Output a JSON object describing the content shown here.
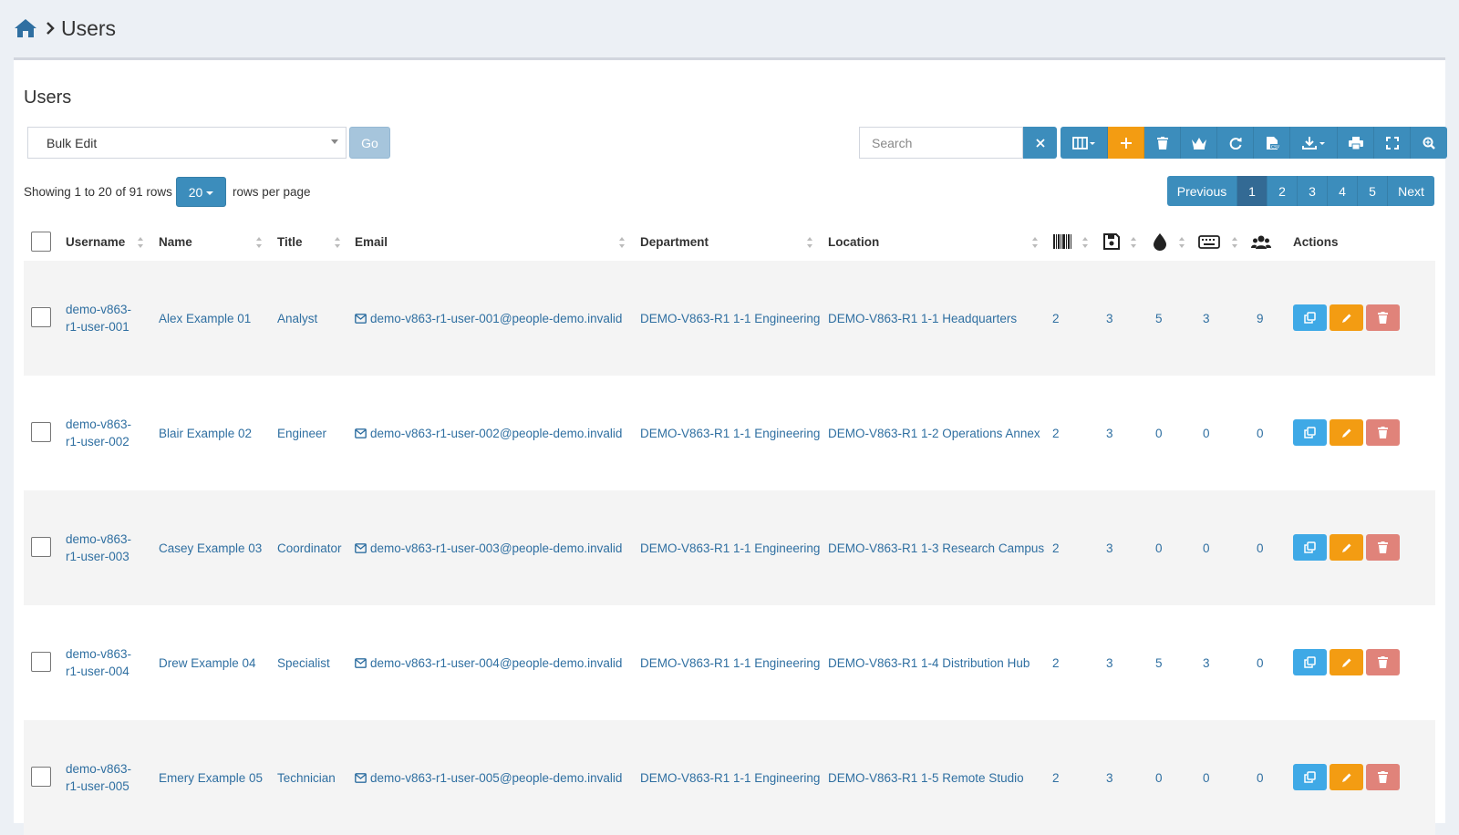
{
  "breadcrumb": {
    "title": "Users"
  },
  "panel": {
    "title": "Users"
  },
  "bulk": {
    "selected": "Bulk Edit",
    "go_label": "Go"
  },
  "search": {
    "placeholder": "Search"
  },
  "toolbar": {
    "buttons": [
      "columns-icon",
      "plus-icon",
      "trash-icon",
      "crown-icon",
      "refresh-icon",
      "csv-icon",
      "download-icon",
      "print-icon",
      "fullscreen-icon",
      "search-advanced-icon"
    ],
    "accent": "#3c8dbc",
    "add_color": "#f39c12"
  },
  "pagination": {
    "showing": "Showing 1 to 20 of 91 rows",
    "rows_per_page": "20",
    "rows_per_page_label": "rows per page",
    "previous": "Previous",
    "pages": [
      "1",
      "2",
      "3",
      "4",
      "5"
    ],
    "active_page": "1",
    "next": "Next"
  },
  "columns": {
    "username": "Username",
    "name": "Name",
    "title": "Title",
    "email": "Email",
    "department": "Department",
    "location": "Location",
    "icon_columns": [
      "barcode-icon",
      "save-icon",
      "drop-icon",
      "keyboard-icon",
      "users-icon"
    ],
    "actions": "Actions"
  },
  "rows": [
    {
      "username_1": "demo-v863-",
      "username_2": "r1-user-001",
      "name": "Alex Example 01",
      "title": "Analyst",
      "email": "demo-v863-r1-user-001@people-demo.invalid",
      "department": "DEMO-V863-R1 1-1 Engineering",
      "location": "DEMO-V863-R1 1-1 Headquarters",
      "c1": "2",
      "c2": "3",
      "c3": "5",
      "c4": "3",
      "c5": "9"
    },
    {
      "username_1": "demo-v863-",
      "username_2": "r1-user-002",
      "name": "Blair Example 02",
      "title": "Engineer",
      "email": "demo-v863-r1-user-002@people-demo.invalid",
      "department": "DEMO-V863-R1 1-1 Engineering",
      "location": "DEMO-V863-R1 1-2 Operations Annex",
      "c1": "2",
      "c2": "3",
      "c3": "0",
      "c4": "0",
      "c5": "0"
    },
    {
      "username_1": "demo-v863-",
      "username_2": "r1-user-003",
      "name": "Casey Example 03",
      "title": "Coordinator",
      "email": "demo-v863-r1-user-003@people-demo.invalid",
      "department": "DEMO-V863-R1 1-1 Engineering",
      "location": "DEMO-V863-R1 1-3 Research Campus",
      "c1": "2",
      "c2": "3",
      "c3": "0",
      "c4": "0",
      "c5": "0"
    },
    {
      "username_1": "demo-v863-",
      "username_2": "r1-user-004",
      "name": "Drew Example 04",
      "title": "Specialist",
      "email": "demo-v863-r1-user-004@people-demo.invalid",
      "department": "DEMO-V863-R1 1-1 Engineering",
      "location": "DEMO-V863-R1 1-4 Distribution Hub",
      "c1": "2",
      "c2": "3",
      "c3": "5",
      "c4": "3",
      "c5": "0"
    },
    {
      "username_1": "demo-v863-",
      "username_2": "r1-user-005",
      "name": "Emery Example 05",
      "title": "Technician",
      "email": "demo-v863-r1-user-005@people-demo.invalid",
      "department": "DEMO-V863-R1 1-1 Engineering",
      "location": "DEMO-V863-R1 1-5 Remote Studio",
      "c1": "2",
      "c2": "3",
      "c3": "0",
      "c4": "0",
      "c5": "0"
    }
  ]
}
